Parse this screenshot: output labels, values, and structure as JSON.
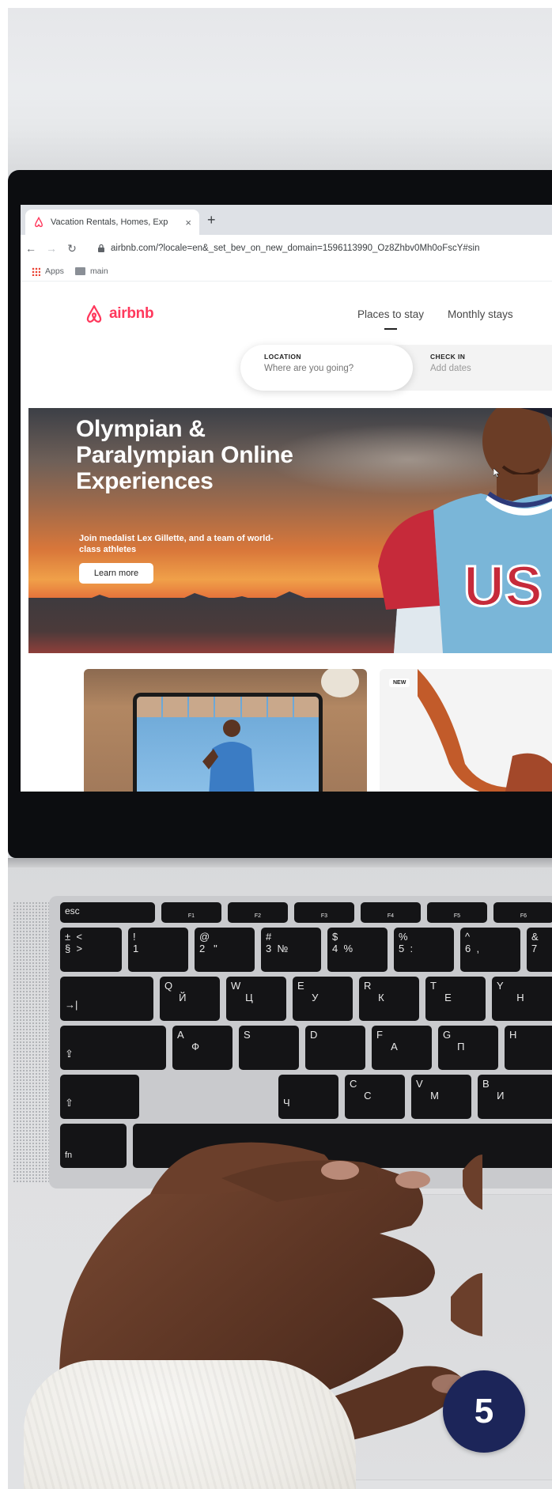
{
  "browser": {
    "tab_title": "Vacation Rentals, Homes, Exp",
    "tab_close": "×",
    "new_tab": "+",
    "back": "←",
    "forward": "→",
    "reload": "↻",
    "url": "airbnb.com/?locale=en&_set_bev_on_new_domain=1596113990_Oz8Zhbv0Mh0oFscY#sin",
    "bookmarks": [
      "Apps",
      "main"
    ]
  },
  "site": {
    "logo_text": "airbnb",
    "brand_color": "#ff385c",
    "nav": [
      "Places to stay",
      "Monthly stays"
    ],
    "search": {
      "location_label": "LOCATION",
      "location_placeholder": "Where are you going?",
      "checkin_label": "CHECK IN",
      "checkin_value": "Add dates"
    },
    "hero": {
      "title": "Olympian & Paralympian Online Experiences",
      "subtitle": "Join medalist Lex Gillette, and a team of world-class athletes",
      "button": "Learn more",
      "jersey_text": "US"
    },
    "cards": {
      "badge": "NEW"
    }
  },
  "keyboard": {
    "esc": "esc",
    "fn_row": [
      "F1",
      "F2",
      "F3",
      "F4",
      "F5",
      "F6"
    ],
    "row1": [
      [
        "±",
        "§"
      ],
      [
        "<",
        ">"
      ],
      [
        "!",
        "1"
      ],
      [
        "@",
        "2",
        "\""
      ],
      [
        "#",
        "3",
        "№"
      ],
      [
        "$",
        "4",
        "%"
      ],
      [
        "%",
        "5",
        ":"
      ],
      [
        "^",
        "6",
        ","
      ],
      [
        "&",
        "7"
      ]
    ],
    "row2": [
      [
        "→|"
      ],
      [
        "Q",
        "Й"
      ],
      [
        "W",
        "Ц"
      ],
      [
        "E",
        "У"
      ],
      [
        "R",
        "К"
      ],
      [
        "T",
        "Е"
      ],
      [
        "Y",
        "Н"
      ]
    ],
    "row3": [
      [
        "⇪"
      ],
      [
        "A",
        "Ф"
      ],
      [
        "S"
      ],
      [
        "D"
      ],
      [
        "F",
        "А"
      ],
      [
        "G",
        "П"
      ],
      [
        "H"
      ]
    ],
    "row4": [
      [
        "⇧"
      ],
      [
        "Ч"
      ],
      [
        "C",
        "С"
      ],
      [
        "V",
        "М"
      ],
      [
        "B",
        "И"
      ]
    ],
    "fn": "fn"
  },
  "badge": {
    "number": "5",
    "color": "#1c2559"
  }
}
